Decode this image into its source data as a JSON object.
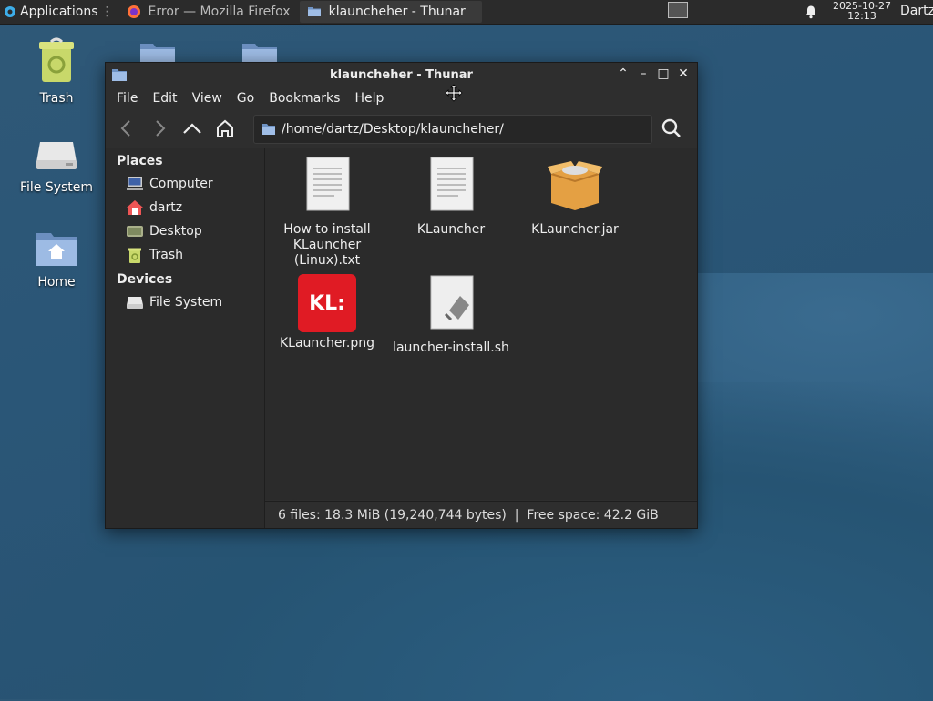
{
  "panel": {
    "applications_label": "Applications",
    "tasks": [
      {
        "label": "Error — Mozilla Firefox",
        "icon": "firefox-icon"
      },
      {
        "label": "klauncheher - Thunar",
        "icon": "folder-icon"
      }
    ],
    "clock_date": "2025-10-27",
    "clock_time": "12:13",
    "user": "Dartz"
  },
  "desktop": {
    "icons": [
      {
        "label": "Trash",
        "icon": "trash-icon"
      },
      {
        "label": "File System",
        "icon": "drive-icon"
      },
      {
        "label": "Home",
        "icon": "home-folder-icon"
      }
    ]
  },
  "window": {
    "title": "klauncheher - Thunar",
    "menu": [
      "File",
      "Edit",
      "View",
      "Go",
      "Bookmarks",
      "Help"
    ],
    "location": "/home/dartz/Desktop/klauncheher/",
    "sidebar": {
      "places_heading": "Places",
      "places": [
        "Computer",
        "dartz",
        "Desktop",
        "Trash"
      ],
      "devices_heading": "Devices",
      "devices": [
        "File System"
      ]
    },
    "files": [
      {
        "name": "How to install KLauncher (Linux).txt",
        "icon": "text-document-icon"
      },
      {
        "name": "KLauncher",
        "icon": "text-document-icon"
      },
      {
        "name": "KLauncher.jar",
        "icon": "package-box-icon"
      },
      {
        "name": "KLauncher.png",
        "icon": "image-icon"
      },
      {
        "name": "launcher-install.sh",
        "icon": "script-icon"
      }
    ],
    "png_logo_text": "KL:",
    "status": "6 files: 18.3 MiB (19,240,744 bytes)  |  Free space: 42.2 GiB"
  },
  "colors": {
    "panel": "#2b2b2b",
    "window": "#2e2e2e",
    "accent_red": "#e01b24"
  }
}
